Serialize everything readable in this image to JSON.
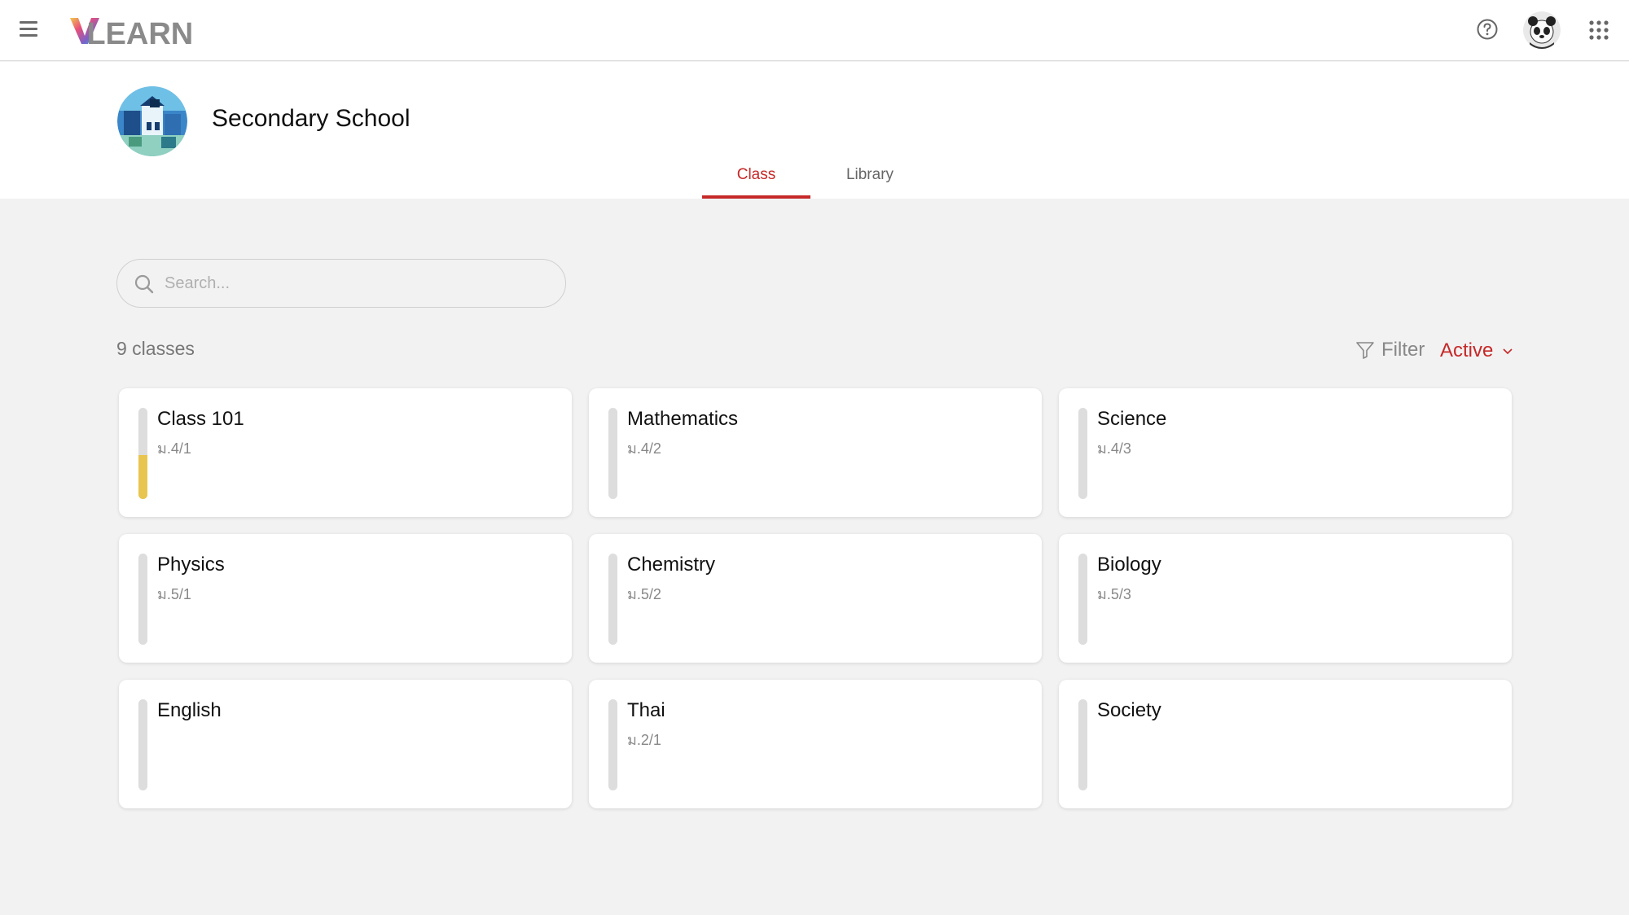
{
  "app": {
    "logo_text": "VLEARN"
  },
  "school": {
    "name": "Secondary School"
  },
  "tabs": [
    {
      "label": "Class",
      "active": true
    },
    {
      "label": "Library",
      "active": false
    }
  ],
  "search": {
    "placeholder": "Search...",
    "value": ""
  },
  "summary": {
    "count_label": "9 classes"
  },
  "filter": {
    "label": "Filter",
    "status": "Active"
  },
  "colors": {
    "accent": "#c62828",
    "progress": "#e8c54f"
  },
  "classes": [
    {
      "title": "Class 101",
      "subtitle": "ม.4/1",
      "progress": 0.48
    },
    {
      "title": "Mathematics",
      "subtitle": "ม.4/2",
      "progress": 0
    },
    {
      "title": "Science",
      "subtitle": "ม.4/3",
      "progress": 0
    },
    {
      "title": "Physics",
      "subtitle": "ม.5/1",
      "progress": 0
    },
    {
      "title": "Chemistry",
      "subtitle": "ม.5/2",
      "progress": 0
    },
    {
      "title": "Biology",
      "subtitle": "ม.5/3",
      "progress": 0
    },
    {
      "title": "English",
      "subtitle": "",
      "progress": 0
    },
    {
      "title": "Thai",
      "subtitle": "ม.2/1",
      "progress": 0
    },
    {
      "title": "Society",
      "subtitle": "",
      "progress": 0
    }
  ]
}
